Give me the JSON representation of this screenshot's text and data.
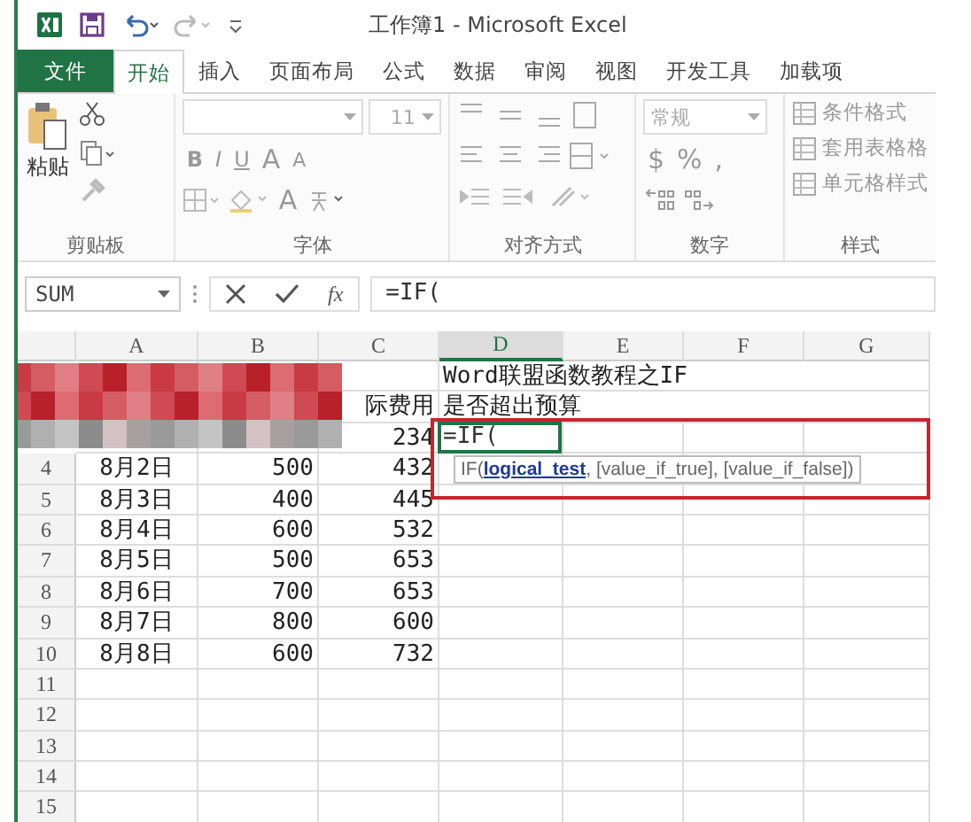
{
  "window": {
    "title": "工作簿1 - Microsoft Excel"
  },
  "tabs": [
    {
      "label": "文件",
      "kind": "file",
      "selected": false
    },
    {
      "label": "开始",
      "kind": "tab",
      "selected": true
    },
    {
      "label": "插入",
      "kind": "tab",
      "selected": false
    },
    {
      "label": "页面布局",
      "kind": "tab",
      "selected": false
    },
    {
      "label": "公式",
      "kind": "tab",
      "selected": false
    },
    {
      "label": "数据",
      "kind": "tab",
      "selected": false
    },
    {
      "label": "审阅",
      "kind": "tab",
      "selected": false
    },
    {
      "label": "视图",
      "kind": "tab",
      "selected": false
    },
    {
      "label": "开发工具",
      "kind": "tab",
      "selected": false
    },
    {
      "label": "加载项",
      "kind": "tab",
      "selected": false
    }
  ],
  "ribbon": {
    "clipboard": {
      "paste": "粘贴",
      "label": "剪贴板"
    },
    "font": {
      "size": "11",
      "styles": [
        "B",
        "I",
        "U"
      ],
      "grow": "A",
      "shrink": "A",
      "font_color": "A",
      "label": "字体"
    },
    "alignment": {
      "label": "对齐方式"
    },
    "number": {
      "format": "常规",
      "currency": "$",
      "percent": "%",
      "comma": ",",
      "label": "数字"
    },
    "styles": {
      "items": [
        "条件格式",
        "套用表格格",
        "单元格样式"
      ],
      "label": "样式"
    }
  },
  "formula_bar": {
    "name_box": "SUM",
    "function_button": "fx",
    "formula": "=IF("
  },
  "sheet": {
    "columns": [
      {
        "label": "A",
        "selected": false
      },
      {
        "label": "B",
        "selected": false
      },
      {
        "label": "C",
        "selected": false
      },
      {
        "label": "D",
        "selected": true
      },
      {
        "label": "E",
        "selected": false
      },
      {
        "label": "F",
        "selected": false
      },
      {
        "label": "G",
        "selected": false
      }
    ],
    "rows": [
      {
        "cells": [
          "",
          "",
          "",
          "Word联盟函数教程之IF",
          "",
          "",
          ""
        ]
      },
      {
        "cells": [
          "",
          "",
          "际费用",
          "是否超出预算",
          "",
          "",
          ""
        ]
      },
      {
        "active": true,
        "cells": [
          "",
          "",
          "234",
          "=IF(",
          "",
          "",
          ""
        ]
      },
      {
        "header": "4",
        "cells": [
          "8月2日",
          "500",
          "432",
          "",
          "",
          "",
          ""
        ]
      },
      {
        "header": "5",
        "cells": [
          "8月3日",
          "400",
          "445",
          "",
          "",
          "",
          ""
        ]
      },
      {
        "header": "6",
        "cells": [
          "8月4日",
          "600",
          "532",
          "",
          "",
          "",
          ""
        ]
      },
      {
        "header": "7",
        "cells": [
          "8月5日",
          "500",
          "653",
          "",
          "",
          "",
          ""
        ]
      },
      {
        "header": "8",
        "cells": [
          "8月6日",
          "700",
          "653",
          "",
          "",
          "",
          ""
        ]
      },
      {
        "header": "9",
        "cells": [
          "8月7日",
          "800",
          "600",
          "",
          "",
          "",
          ""
        ]
      },
      {
        "header": "10",
        "cells": [
          "8月8日",
          "600",
          "732",
          "",
          "",
          "",
          ""
        ]
      },
      {
        "header": "11",
        "cells": [
          "",
          "",
          "",
          "",
          "",
          "",
          ""
        ]
      },
      {
        "header": "12",
        "cells": [
          "",
          "",
          "",
          "",
          "",
          "",
          ""
        ]
      },
      {
        "header": "13",
        "cells": [
          "",
          "",
          "",
          "",
          "",
          "",
          ""
        ]
      },
      {
        "header": "14",
        "cells": [
          "",
          "",
          "",
          "",
          "",
          "",
          ""
        ]
      },
      {
        "header": "15",
        "cells": [
          "",
          "",
          "",
          "",
          "",
          "",
          ""
        ]
      }
    ]
  },
  "tooltip": {
    "function": "IF(",
    "current_argument": "logical_test",
    "rest": ", [value_if_true], [value_if_false])"
  },
  "redaction": {
    "kind": "pixelate"
  },
  "highlight": {
    "kind": "rectangle"
  }
}
